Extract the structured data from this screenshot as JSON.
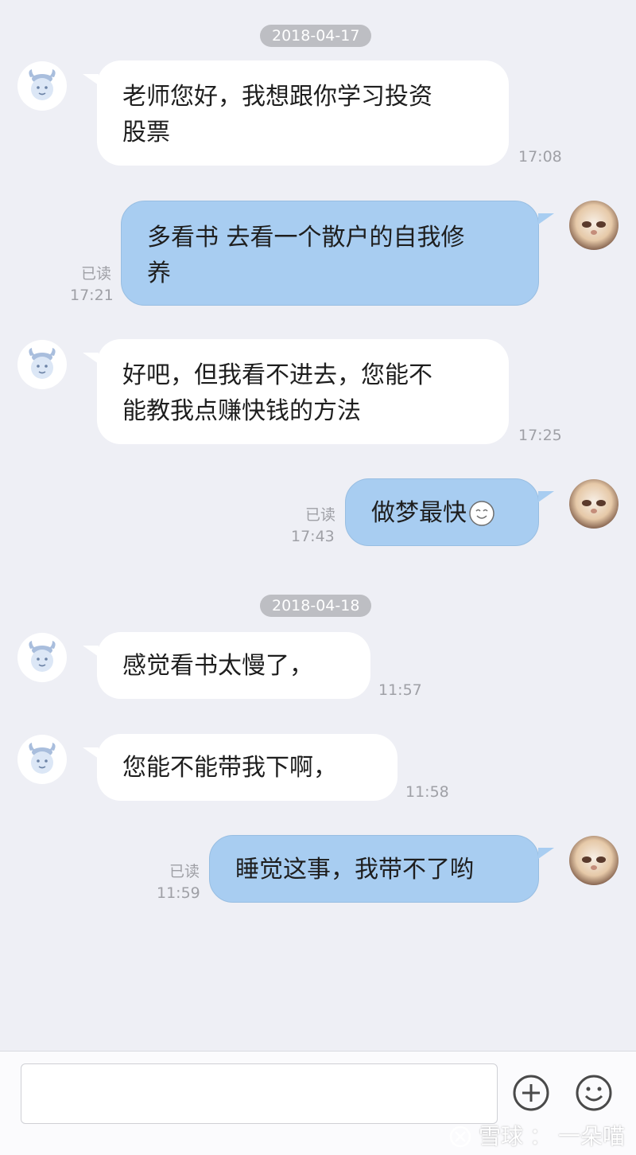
{
  "dates": [
    "2018-04-17",
    "2018-04-18"
  ],
  "messages": [
    {
      "sender": "user",
      "text": "老师您好，我想跟你学习投资股票",
      "time": "17:08"
    },
    {
      "sender": "me",
      "text": "多看书 去看一个散户的自我修养",
      "time": "17:21",
      "read": "已读"
    },
    {
      "sender": "user",
      "text": "好吧，但我看不进去，您能不能教我点赚快钱的方法",
      "time": "17:25"
    },
    {
      "sender": "me",
      "text": "做梦最快☺",
      "time": "17:43",
      "read": "已读"
    },
    {
      "sender": "user",
      "text": "感觉看书太慢了，",
      "time": "11:57"
    },
    {
      "sender": "user",
      "text": "您能不能带我下啊，",
      "time": "11:58"
    },
    {
      "sender": "me",
      "text": "睡觉这事，我带不了哟",
      "time": "11:59",
      "read": "已读"
    }
  ],
  "lines": {
    "m0": [
      "老师您好，我想跟你学习投资",
      "股票"
    ],
    "m1": [
      "多看书 去看一个散户的自我修",
      "养"
    ],
    "m2": [
      "好吧，但我看不进去，您能不",
      "能教我点赚快钱的方法"
    ],
    "m3": [
      "做梦最快"
    ],
    "m6": [
      "睡觉这事，我带不了哟"
    ]
  },
  "input": {
    "value": "",
    "placeholder": ""
  },
  "toolbar": {
    "add_icon": "plus-circle-icon",
    "emoji_icon": "smile-icon"
  },
  "watermark": {
    "brand": "雪球",
    "separator": "：",
    "author": "一朵喵"
  },
  "colors": {
    "background": "#EEEFF5",
    "incoming_bubble": "#FFFFFF",
    "outgoing_bubble": "#A8CDF1",
    "date_chip": "#BDBEC3",
    "meta_text": "#9FA0A6"
  }
}
